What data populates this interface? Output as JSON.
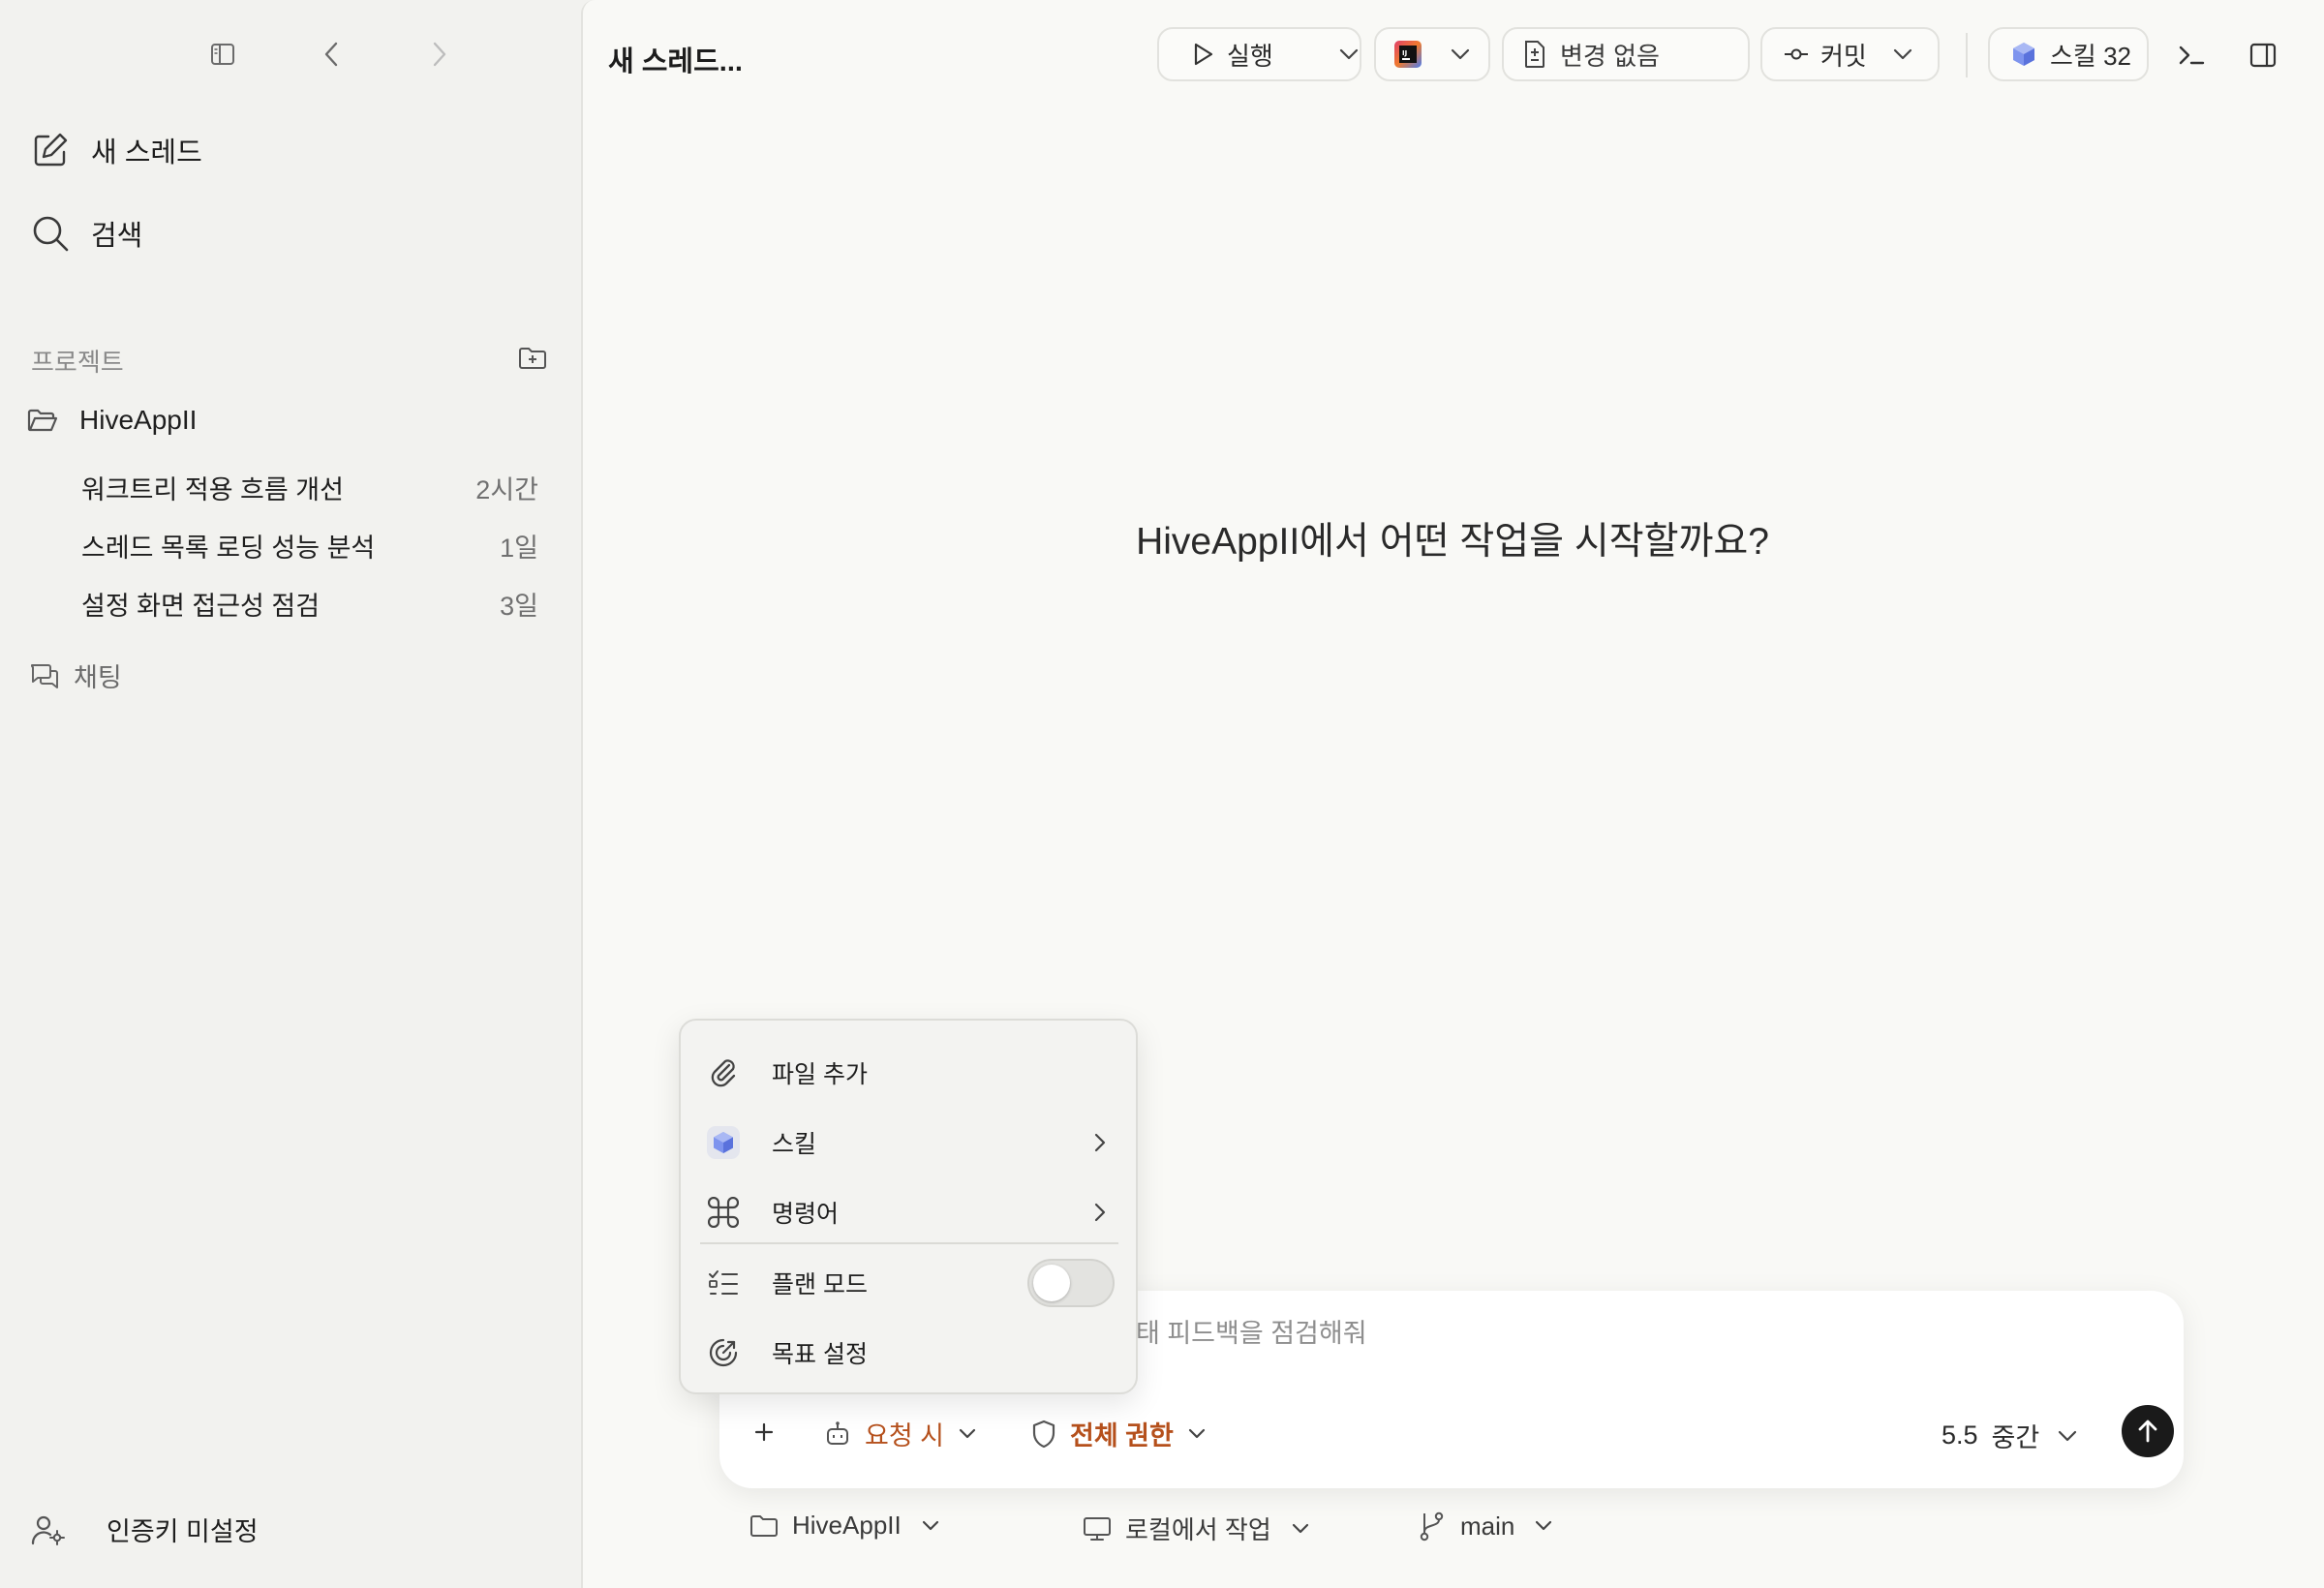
{
  "sidebar": {
    "new_thread": "새 스레드",
    "search": "검색",
    "projects_header": "프로젝트",
    "project_name": "HiveAppII",
    "threads": [
      {
        "title": "워크트리 적용 흐름 개선",
        "age": "2시간"
      },
      {
        "title": "스레드 목록 로딩 성능 분석",
        "age": "1일"
      },
      {
        "title": "설정 화면 접근성 점검",
        "age": "3일"
      }
    ],
    "chat": "채팅",
    "auth_status": "인증키 미설정"
  },
  "header": {
    "title": "새 스레드...",
    "run_label": "실행",
    "changes_label": "변경 없음",
    "commit_label": "커밋",
    "skills_label": "스킬 32"
  },
  "main": {
    "prompt": "HiveAppII에서 어떤 작업을 시작할까요?"
  },
  "composer": {
    "partial_text": "태 피드백을 점검해줘",
    "mode_label": "요청 시",
    "permission_label": "전체 권한",
    "model_version": "5.5",
    "model_effort": "중간"
  },
  "menu": {
    "add_file": "파일 추가",
    "skills": "스킬",
    "commands": "명령어",
    "plan_mode": "플랜 모드",
    "plan_mode_on": false,
    "set_goal": "목표 설정"
  },
  "footer": {
    "project": "HiveAppII",
    "location": "로컬에서 작업",
    "branch": "main"
  },
  "colors": {
    "accent": "#b5501c",
    "send_button": "#1a1a1a",
    "skill_cube": "#6f86e6"
  }
}
